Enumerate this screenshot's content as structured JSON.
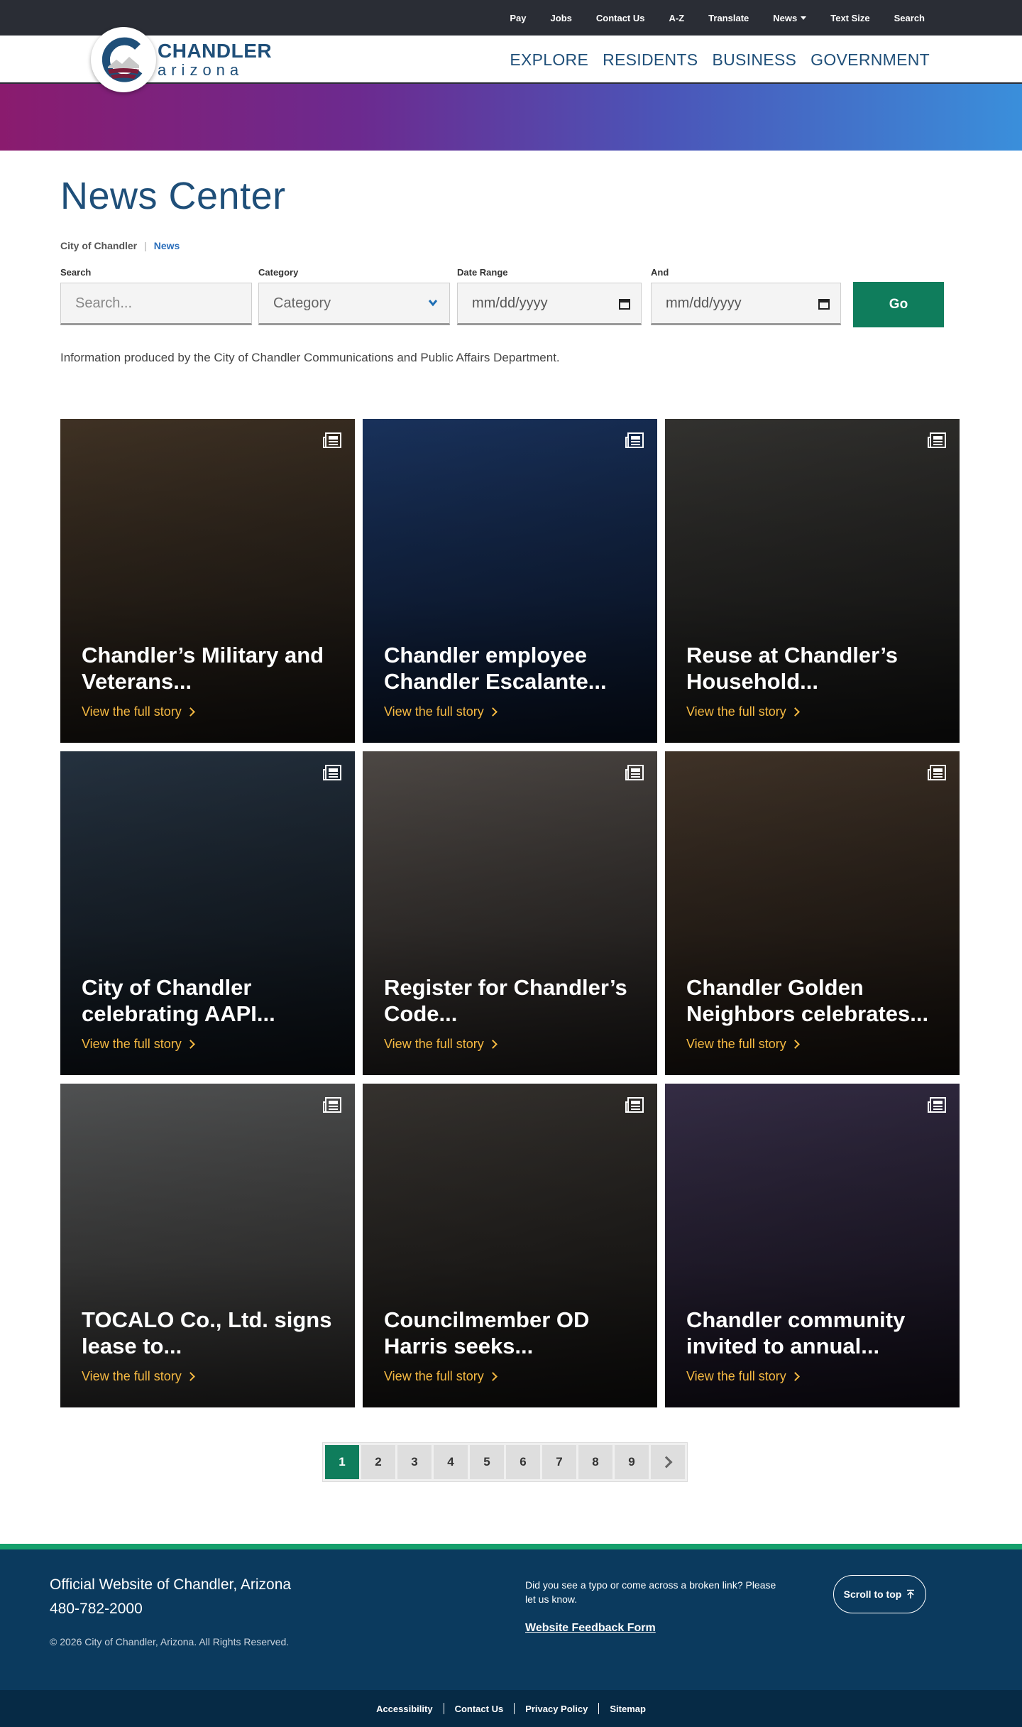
{
  "utility_nav": [
    {
      "label": "Pay"
    },
    {
      "label": "Jobs"
    },
    {
      "label": "Contact Us"
    },
    {
      "label": "A-Z"
    },
    {
      "label": "Translate"
    },
    {
      "label": "News",
      "has_dropdown": true
    },
    {
      "label": "Text Size"
    },
    {
      "label": "Search"
    }
  ],
  "logo": {
    "main": "CHANDLER",
    "sub": "arizona"
  },
  "main_nav": [
    {
      "label": "EXPLORE"
    },
    {
      "label": "RESIDENTS"
    },
    {
      "label": "BUSINESS"
    },
    {
      "label": "GOVERNMENT"
    }
  ],
  "page": {
    "title": "News Center"
  },
  "breadcrumb": {
    "home": "City of Chandler",
    "current": "News"
  },
  "filters": {
    "search": {
      "label": "Search",
      "placeholder": "Search..."
    },
    "category": {
      "label": "Category",
      "value": "Category"
    },
    "date_from": {
      "label": "Date Range",
      "placeholder": "mm/dd/yyyy"
    },
    "date_to": {
      "label": "And",
      "placeholder": "mm/dd/yyyy"
    },
    "go_label": "Go"
  },
  "info_text": "Information produced by the City of Chandler Communications and Public Affairs Department.",
  "cards": [
    {
      "title": "Chandler’s Military and Veterans...",
      "link": "View the full story",
      "tone_a": "#4a3a2a",
      "tone_b": "#1e1a16"
    },
    {
      "title": "Chandler employee Chandler Escalante...",
      "link": "View the full story",
      "tone_a": "#1d3a6b",
      "tone_b": "#0d1a33"
    },
    {
      "title": "Reuse at Chandler’s Household...",
      "link": "View the full story",
      "tone_a": "#3b3a37",
      "tone_b": "#1a1a19"
    },
    {
      "title": "City of Chandler celebrating AAPI...",
      "link": "View the full story",
      "tone_a": "#2b3a4a",
      "tone_b": "#111820"
    },
    {
      "title": "Register for Chandler’s Code...",
      "link": "View the full story",
      "tone_a": "#5a5450",
      "tone_b": "#2a2624"
    },
    {
      "title": "Chandler Golden Neighbors celebrates...",
      "link": "View the full story",
      "tone_a": "#4a3b2e",
      "tone_b": "#1f1813"
    },
    {
      "title": "TOCALO Co., Ltd. signs lease to...",
      "link": "View the full story",
      "tone_a": "#5d5f60",
      "tone_b": "#3a3836"
    },
    {
      "title": "Councilmember OD Harris seeks...",
      "link": "View the full story",
      "tone_a": "#3e3a36",
      "tone_b": "#1a1816"
    },
    {
      "title": "Chandler community invited to annual...",
      "link": "View the full story",
      "tone_a": "#3d3450",
      "tone_b": "#1c1626"
    }
  ],
  "pagination": {
    "pages": [
      "1",
      "2",
      "3",
      "4",
      "5",
      "6",
      "7",
      "8",
      "9"
    ],
    "current": "1"
  },
  "footer": {
    "site_name": "Official Website of Chandler, Arizona",
    "phone": "480-782-2000",
    "copyright": "© 2026 City of Chandler, Arizona. All Rights Reserved.",
    "typo_text": "Did you see a typo or come across a broken link? Please let us know.",
    "feedback_link": "Website Feedback Form",
    "scroll_top": "Scroll to top"
  },
  "bottom_links": [
    {
      "label": "Accessibility"
    },
    {
      "label": "Contact Us"
    },
    {
      "label": "Privacy Policy"
    },
    {
      "label": "Sitemap"
    }
  ],
  "colors": {
    "brand_blue": "#1f4f79",
    "accent_green": "#0f7d5c",
    "link_gold": "#f5b942",
    "footer_bg": "#0b3a5e"
  }
}
